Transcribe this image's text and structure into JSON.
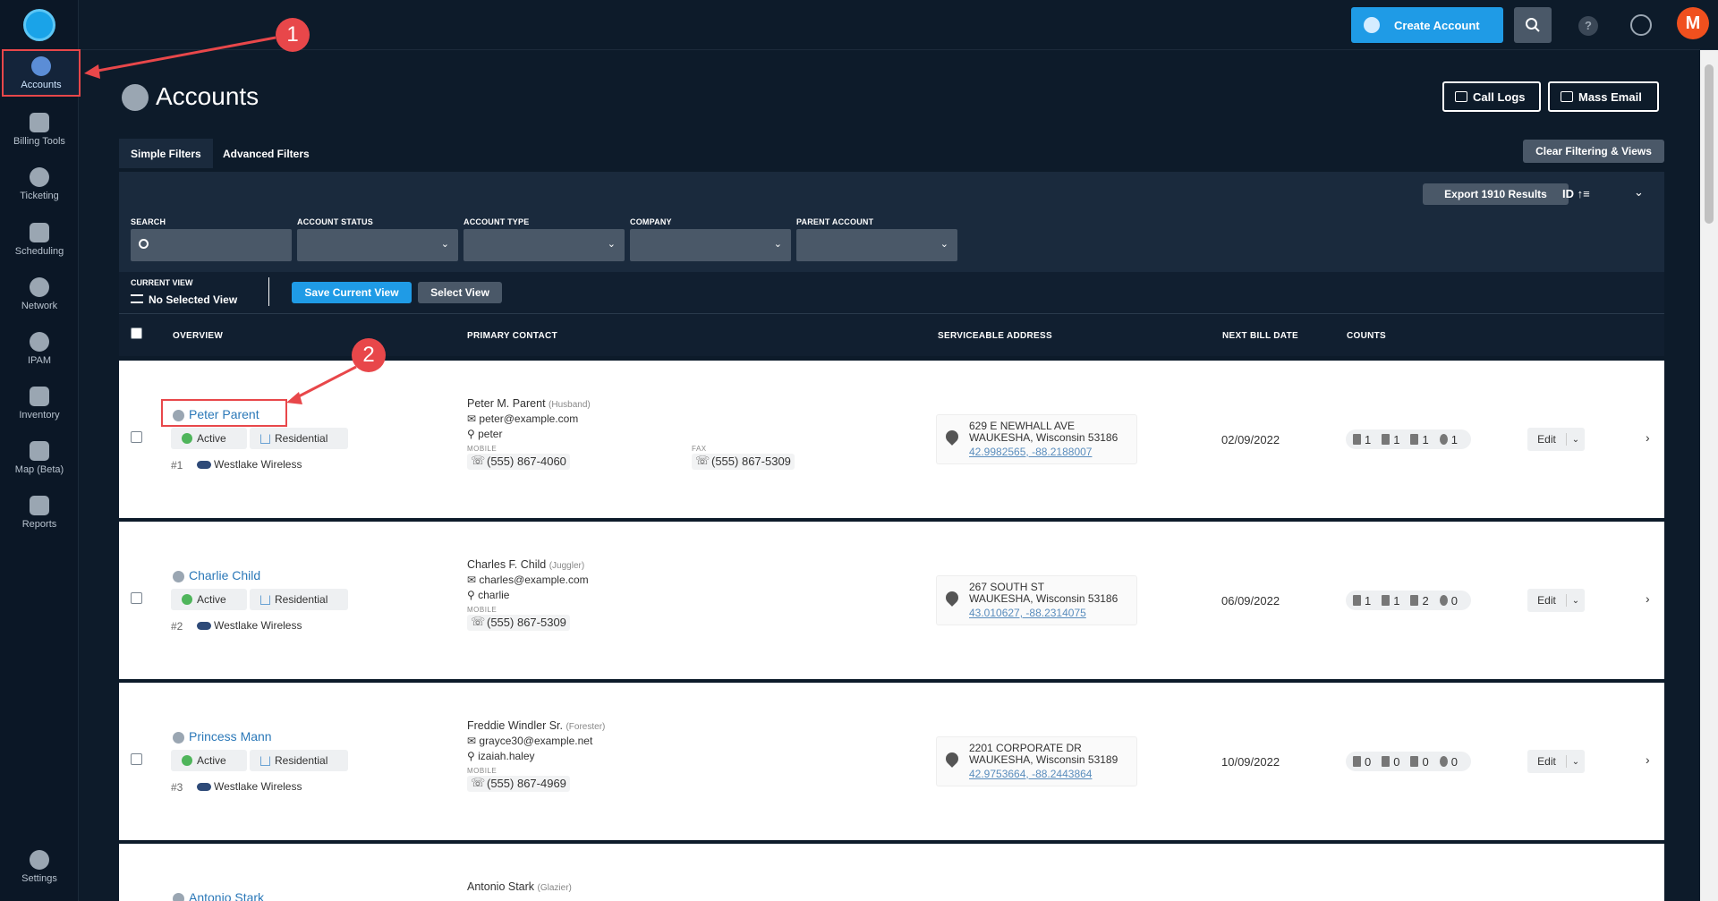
{
  "sidebar": {
    "items": [
      {
        "label": "Accounts",
        "icon": "user-icon"
      },
      {
        "label": "Billing Tools",
        "icon": "calculator-icon"
      },
      {
        "label": "Ticketing",
        "icon": "chat-icon"
      },
      {
        "label": "Scheduling",
        "icon": "calendar-icon"
      },
      {
        "label": "Network",
        "icon": "network-icon"
      },
      {
        "label": "IPAM",
        "icon": "ipam-icon"
      },
      {
        "label": "Inventory",
        "icon": "cart-icon"
      },
      {
        "label": "Map (Beta)",
        "icon": "map-icon"
      },
      {
        "label": "Reports",
        "icon": "report-icon"
      },
      {
        "label": "Settings",
        "icon": "gear-icon"
      }
    ]
  },
  "topbar": {
    "create_label": "Create Account",
    "help_label": "?",
    "avatar_initial": "M"
  },
  "page": {
    "title": "Accounts",
    "call_logs": "Call Logs",
    "mass_email": "Mass Email"
  },
  "filters": {
    "tabs": [
      "Simple Filters",
      "Advanced Filters"
    ],
    "clear": "Clear Filtering & Views",
    "export": "Export 1910 Results",
    "sort": "ID ↑≡",
    "labels": [
      "SEARCH",
      "ACCOUNT STATUS",
      "ACCOUNT TYPE",
      "COMPANY",
      "PARENT ACCOUNT"
    ]
  },
  "view": {
    "label": "CURRENT VIEW",
    "value": "No Selected View",
    "save": "Save Current View",
    "select": "Select View"
  },
  "table": {
    "headers": [
      "OVERVIEW",
      "PRIMARY CONTACT",
      "SERVICEABLE ADDRESS",
      "NEXT BILL DATE",
      "COUNTS"
    ],
    "rows": [
      {
        "name": "Peter Parent",
        "status": "Active",
        "type": "Residential",
        "id": "#1",
        "company": "Westlake Wireless",
        "contact": "Peter M. Parent",
        "relation": "(Husband)",
        "email": "peter@example.com",
        "username": "peter",
        "mobile_label": "MOBILE",
        "mobile": "(555) 867-4060",
        "fax_label": "FAX",
        "fax": "(555) 867-5309",
        "addr1": "629 E NEWHALL AVE",
        "addr2": "WAUKESHA, Wisconsin 53186",
        "geo": "42.9982565, -88.2188007",
        "bill": "02/09/2022",
        "counts": [
          "1",
          "1",
          "1",
          "1"
        ],
        "edit": "Edit"
      },
      {
        "name": "Charlie Child",
        "status": "Active",
        "type": "Residential",
        "id": "#2",
        "company": "Westlake Wireless",
        "contact": "Charles F. Child",
        "relation": "(Juggler)",
        "email": "charles@example.com",
        "username": "charlie",
        "mobile_label": "MOBILE",
        "mobile": "(555) 867-5309",
        "addr1": "267 SOUTH ST",
        "addr2": "WAUKESHA, Wisconsin 53186",
        "geo": "43.010627, -88.2314075",
        "bill": "06/09/2022",
        "counts": [
          "1",
          "1",
          "2",
          "0"
        ],
        "edit": "Edit"
      },
      {
        "name": "Princess Mann",
        "status": "Active",
        "type": "Residential",
        "id": "#3",
        "company": "Westlake Wireless",
        "contact": "Freddie Windler Sr.",
        "relation": "(Forester)",
        "email": "grayce30@example.net",
        "username": "izaiah.haley",
        "mobile_label": "MOBILE",
        "mobile": "(555) 867-4969",
        "addr1": "2201 CORPORATE DR",
        "addr2": "WAUKESHA, Wisconsin 53189",
        "geo": "42.9753664, -88.2443864",
        "bill": "10/09/2022",
        "counts": [
          "0",
          "0",
          "0",
          "0"
        ],
        "edit": "Edit"
      },
      {
        "name": "Antonio Stark",
        "contact": "Antonio Stark",
        "relation": "(Glazier)"
      }
    ]
  },
  "annotations": [
    "1",
    "2"
  ],
  "colors": {
    "accent": "#1f9be6",
    "annotation": "#e8474a",
    "background": "#0d1b2a"
  }
}
